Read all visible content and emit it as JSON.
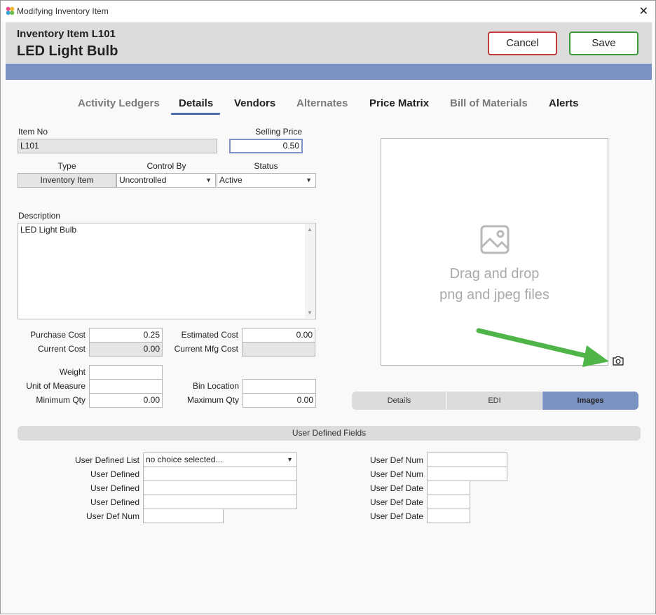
{
  "window": {
    "title": "Modifying Inventory Item",
    "close_glyph": "✕"
  },
  "header": {
    "subtitle": "Inventory Item L101",
    "title": "LED Light Bulb",
    "cancel_label": "Cancel",
    "save_label": "Save"
  },
  "tabs": [
    {
      "label": "Activity Ledgers",
      "state": "dim"
    },
    {
      "label": "Details",
      "state": "active"
    },
    {
      "label": "Vendors",
      "state": "normal"
    },
    {
      "label": "Alternates",
      "state": "dim"
    },
    {
      "label": "Price Matrix",
      "state": "normal"
    },
    {
      "label": "Bill of Materials",
      "state": "dim"
    },
    {
      "label": "Alerts",
      "state": "normal"
    }
  ],
  "form": {
    "item_no_label": "Item No",
    "item_no_value": "L101",
    "selling_price_label": "Selling Price",
    "selling_price_value": "0.50",
    "type_label": "Type",
    "type_value": "Inventory Item",
    "control_by_label": "Control By",
    "control_by_value": "Uncontrolled",
    "status_label": "Status",
    "status_value": "Active",
    "description_label": "Description",
    "description_value": "LED Light Bulb",
    "purchase_cost_label": "Purchase Cost",
    "purchase_cost_value": "0.25",
    "current_cost_label": "Current Cost",
    "current_cost_value": "0.00",
    "estimated_cost_label": "Estimated Cost",
    "estimated_cost_value": "0.00",
    "current_mfg_cost_label": "Current Mfg Cost",
    "current_mfg_cost_value": "",
    "weight_label": "Weight",
    "weight_value": "",
    "uom_label": "Unit of Measure",
    "uom_value": "",
    "bin_location_label": "Bin Location",
    "bin_location_value": "",
    "min_qty_label": "Minimum Qty",
    "min_qty_value": "0.00",
    "max_qty_label": "Maximum Qty",
    "max_qty_value": "0.00"
  },
  "image_panel": {
    "drop_line1": "Drag and drop",
    "drop_line2": "png and jpeg files",
    "icon": "image-placeholder-icon",
    "camera_icon": "camera-icon"
  },
  "segments": [
    {
      "label": "Details",
      "active": false
    },
    {
      "label": "EDI",
      "active": false
    },
    {
      "label": "Images",
      "active": true
    }
  ],
  "udf": {
    "section_title": "User Defined Fields",
    "user_defined_list_label": "User Defined List",
    "user_defined_list_value": "no choice selected...",
    "user_defined_label": "User Defined",
    "user_def_num_label": "User Def Num",
    "user_def_date_label": "User Def Date"
  },
  "colors": {
    "accent": "#7a93c2",
    "cancel_border": "#c23a3a",
    "save_border": "#3a9a3a",
    "annotation_arrow": "#4fb548"
  }
}
